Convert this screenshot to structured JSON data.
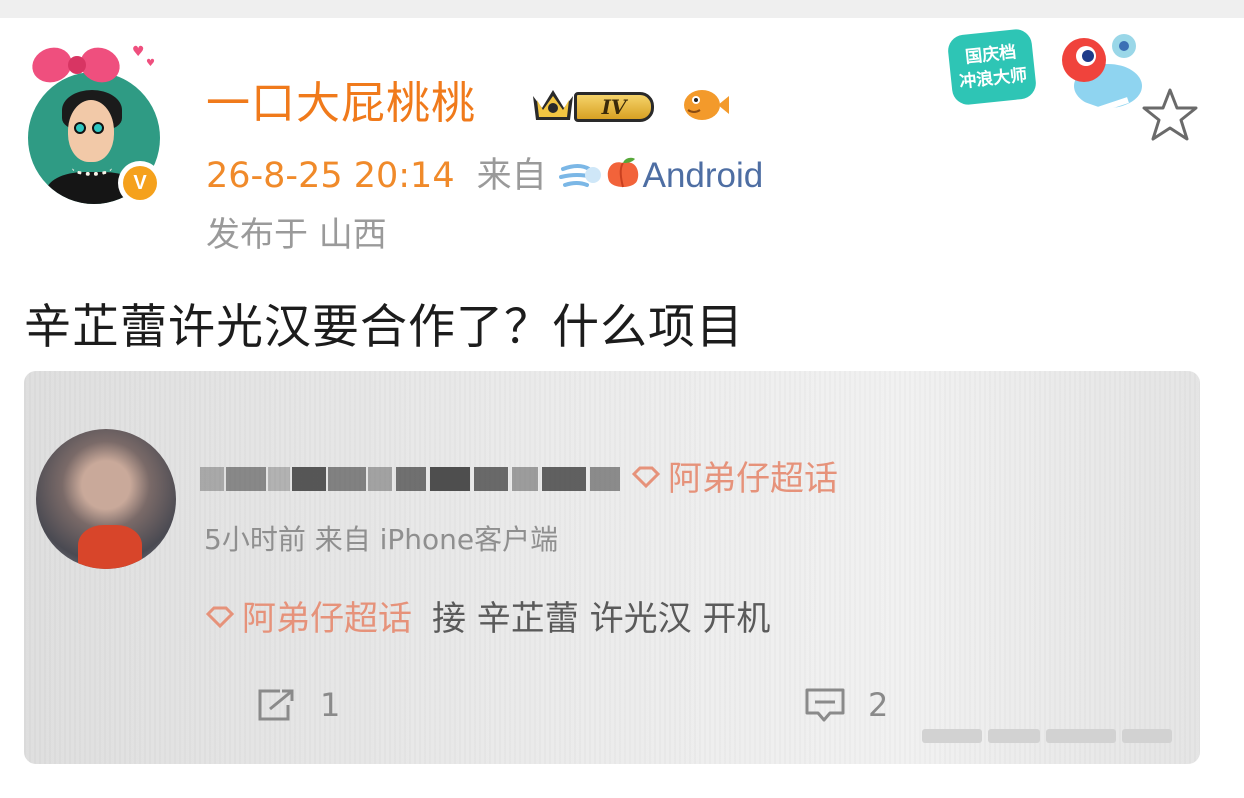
{
  "post": {
    "username": "一口大屁桃桃",
    "level_badge": "IV",
    "timestamp": "26-8-25 20:14",
    "source_prefix": "来自",
    "source_device": "Android",
    "location": "发布于 山西",
    "text": "辛芷蕾许光汉要合作了？什么项目",
    "event_badge": {
      "line1": "国庆档",
      "line2": "冲浪大师"
    }
  },
  "embedded_screenshot": {
    "topic_tag": "阿弟仔超话",
    "meta": "5小时前  来自 iPhone客户端",
    "body_tag": "阿弟仔超话",
    "body_text": "接 辛芷蕾 许光汉 开机",
    "repost_count": "1",
    "comment_count": "2"
  },
  "colors": {
    "username": "#f07a1b",
    "timestamp": "#f08a2a",
    "device_link": "#4e6ea3",
    "verified_badge": "#f5a11c",
    "topic_tag": "#e6927a"
  },
  "icons": {
    "verified": "verified-v-icon",
    "favorite": "star-outline-icon",
    "repost": "repost-icon",
    "comment": "comment-icon"
  }
}
